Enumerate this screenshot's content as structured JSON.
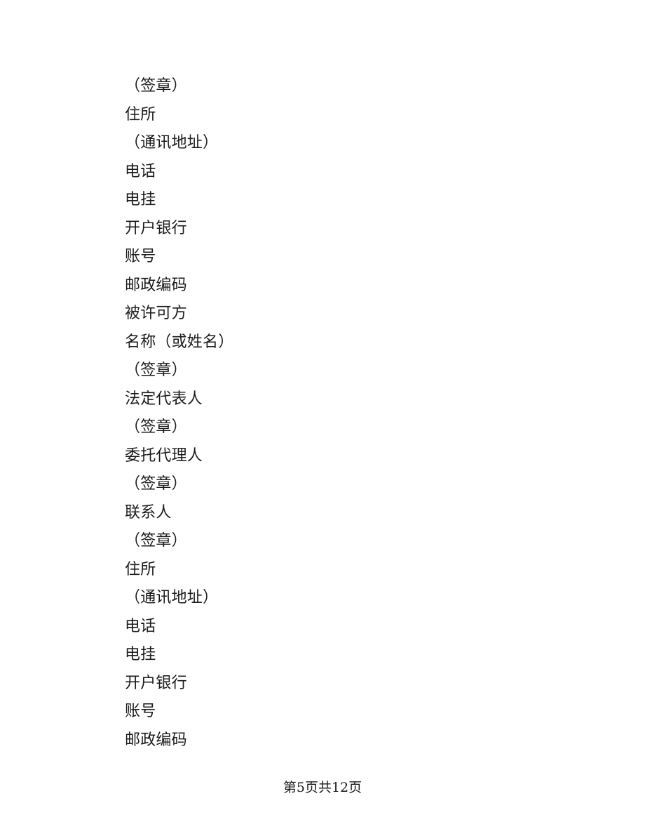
{
  "document": {
    "background_color": "#ffffff",
    "text_color": "#1b1b1b",
    "lines": [
      {
        "text": "（签章）"
      },
      {
        "text": "住所"
      },
      {
        "text": "（通讯地址）"
      },
      {
        "text": "电话"
      },
      {
        "text": "电挂"
      },
      {
        "text": "开户银行"
      },
      {
        "text": "账号"
      },
      {
        "text": "邮政编码"
      },
      {
        "text": "被许可方"
      },
      {
        "text": "名称（或姓名）"
      },
      {
        "text": "（签章）"
      },
      {
        "text": "法定代表人"
      },
      {
        "text": "（签章）"
      },
      {
        "text": "委托代理人"
      },
      {
        "text": "（签章）"
      },
      {
        "text": "联系人"
      },
      {
        "text": "（签章）"
      },
      {
        "text": "住所"
      },
      {
        "text": "（通讯地址）"
      },
      {
        "text": "电话"
      },
      {
        "text": "电挂"
      },
      {
        "text": "开户银行"
      },
      {
        "text": "账号"
      },
      {
        "text": "邮政编码"
      }
    ]
  },
  "footer": {
    "page_label": "第5页共12页",
    "current_page": 5,
    "total_pages": 12
  }
}
